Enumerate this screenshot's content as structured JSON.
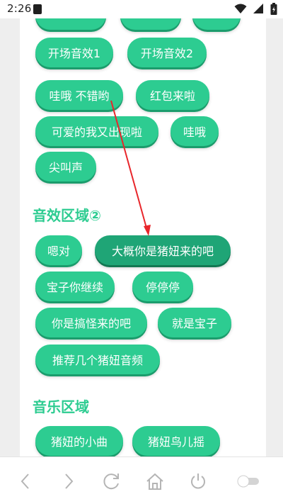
{
  "status_bar": {
    "time": "2:26"
  },
  "colors": {
    "accent": "#2dcc91",
    "accent_dark": "#1fa576",
    "arrow": "#e8262b"
  },
  "sections": [
    {
      "buttons": [
        "开场音效1",
        "开场音效2",
        "哇哦 不错哟",
        "红包来啦",
        "可爱的我又出现啦",
        "哇哦",
        "尖叫声"
      ]
    },
    {
      "title": "音效区域②",
      "buttons": [
        "嗯对",
        "大概你是猪妞来的吧",
        "宝子你继续",
        "停停停",
        "你是搞怪来的吧",
        "就是宝子",
        "推荐几个猪妞音频"
      ]
    },
    {
      "title": "音乐区域",
      "buttons": [
        "猪妞的小曲",
        "猪妞鸟儿摇"
      ]
    }
  ],
  "bottom_nav": {
    "icons": [
      "back-icon",
      "forward-icon",
      "refresh-icon",
      "home-icon",
      "power-icon",
      "toggle-icon"
    ]
  }
}
